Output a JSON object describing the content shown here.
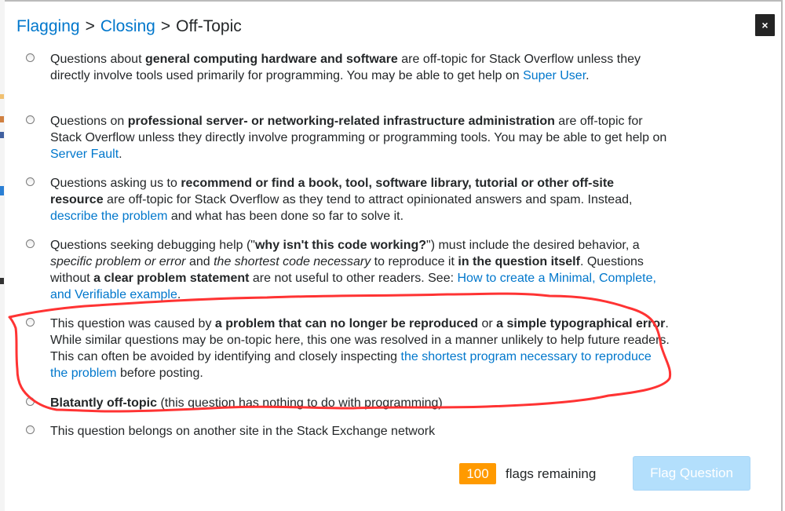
{
  "breadcrumb": {
    "items": [
      {
        "label": "Flagging",
        "link": true
      },
      {
        "label": "Closing",
        "link": true
      },
      {
        "label": "Off-Topic",
        "link": false
      }
    ],
    "separator": ">"
  },
  "close_button": {
    "label": "×"
  },
  "options": [
    {
      "segments": [
        {
          "t": "Questions about "
        },
        {
          "t": "general computing hardware and software",
          "b": true
        },
        {
          "t": " are off-topic for Stack Overflow unless they directly involve tools used primarily for programming. You may be able to get help on "
        },
        {
          "t": "Super User",
          "link": true
        },
        {
          "t": "."
        }
      ]
    },
    {
      "segments": [
        {
          "t": "Questions on "
        },
        {
          "t": "professional server- or networking-related infrastructure administration",
          "b": true
        },
        {
          "t": " are off-topic for Stack Overflow unless they directly involve programming or programming tools. You may be able to get help on "
        },
        {
          "t": "Server Fault",
          "link": true
        },
        {
          "t": "."
        }
      ]
    },
    {
      "segments": [
        {
          "t": "Questions asking us to "
        },
        {
          "t": "recommend or find a book, tool, software library, tutorial or other off-site resource",
          "b": true
        },
        {
          "t": " are off-topic for Stack Overflow as they tend to attract opinionated answers and spam. Instead, "
        },
        {
          "t": "describe the problem",
          "link": true
        },
        {
          "t": " and what has been done so far to solve it."
        }
      ]
    },
    {
      "segments": [
        {
          "t": "Questions seeking debugging help (\""
        },
        {
          "t": "why isn't this code working?",
          "b": true
        },
        {
          "t": "\") must include the desired behavior, a "
        },
        {
          "t": "specific problem or error",
          "i": true
        },
        {
          "t": " and "
        },
        {
          "t": "the shortest code necessary",
          "i": true
        },
        {
          "t": " to reproduce it "
        },
        {
          "t": "in the question itself",
          "b": true
        },
        {
          "t": ". Questions without "
        },
        {
          "t": "a clear problem statement",
          "b": true
        },
        {
          "t": " are not useful to other readers. See: "
        },
        {
          "t": "How to create a Minimal, Complete, and Verifiable example",
          "link": true
        },
        {
          "t": "."
        }
      ]
    },
    {
      "segments": [
        {
          "t": "This question was caused by "
        },
        {
          "t": "a problem that can no longer be reproduced",
          "b": true
        },
        {
          "t": " or "
        },
        {
          "t": "a simple typographical error",
          "b": true
        },
        {
          "t": ". While similar questions may be on-topic here, this one was resolved in a manner unlikely to help future readers. This can often be avoided by identifying and closely inspecting "
        },
        {
          "t": "the shortest program necessary to reproduce the problem",
          "link": true
        },
        {
          "t": " before posting."
        }
      ]
    },
    {
      "segments": [
        {
          "t": "Blatantly off-topic",
          "b": true
        },
        {
          "t": " (this question has nothing to do with programming)"
        }
      ]
    },
    {
      "segments": [
        {
          "t": "This question belongs on another site in the Stack Exchange network"
        }
      ]
    }
  ],
  "footer": {
    "flags_count": "100",
    "flags_text": "flags remaining",
    "submit_label": "Flag Question",
    "submit_disabled": true
  },
  "colors": {
    "link": "#0077cc",
    "badge": "#ff9a00",
    "button_disabled": "#b3dffc",
    "annotation": "#ff3333"
  },
  "annotation": {
    "type": "hand-drawn loop",
    "target_option_indexes": [
      4,
      5
    ]
  }
}
